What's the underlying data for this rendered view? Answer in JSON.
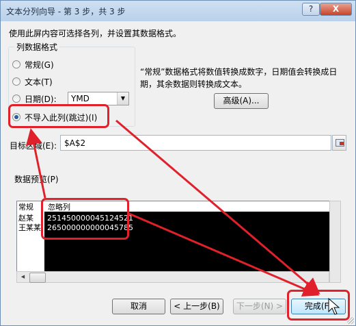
{
  "window": {
    "title": "文本分列向导 - 第 3 步，共 3 步",
    "help_glyph": "?",
    "close_glyph": "X"
  },
  "instruction": "使用此屏内容可选择各列，并设置其数据格式。",
  "column_format": {
    "title": "列数据格式",
    "options": [
      {
        "label": "常规(G)",
        "selected": false
      },
      {
        "label": "文本(T)",
        "selected": false
      },
      {
        "label": "日期(D):",
        "selected": false
      },
      {
        "label": "不导入此列(跳过)(I)",
        "selected": true
      }
    ],
    "date_format": "YMD"
  },
  "description": "“常规”数据格式将数值转换成数字，日期值会转换成日期，其余数据则转换成文本。",
  "advanced_button": "高级(A)...",
  "target": {
    "label": "目标区域(E):",
    "value": "$A$2"
  },
  "preview": {
    "title": "数据预览(P)",
    "headers": [
      "常规",
      "忽略列"
    ],
    "rows": [
      [
        "赵某",
        "251450000045124521"
      ],
      [
        "王某某",
        "265000000000045785"
      ]
    ]
  },
  "buttons": {
    "cancel": "取消",
    "back": "< 上一步(B)",
    "next": "下一步(N) >",
    "finish": "完成(F)"
  },
  "colors": {
    "annotation_red": "#e0202a",
    "selected_column_bg": "#000000"
  }
}
